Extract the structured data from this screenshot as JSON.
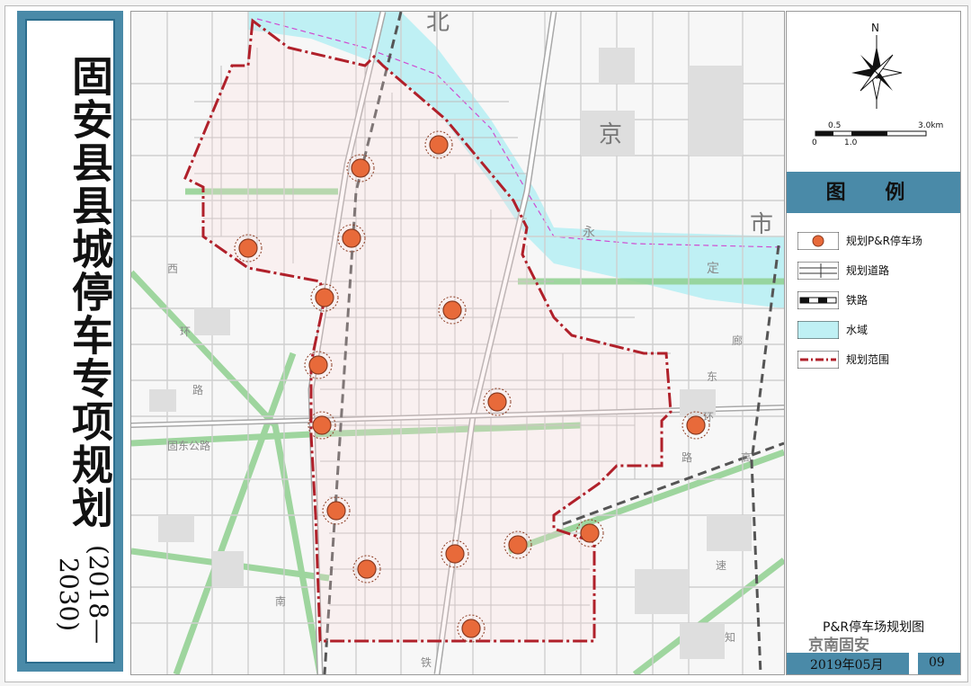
{
  "title": {
    "main": "固安县县城停车专项规划",
    "years": "(2018—2030)"
  },
  "map": {
    "place_labels": {
      "bei": "北",
      "jing": "京",
      "shi": "市",
      "yong": "永",
      "ding": "定",
      "xi": "西",
      "huan": "环",
      "lu": "路",
      "gudong_lu": "固东公路",
      "nan": "南",
      "tie": "铁",
      "langfang": "廊",
      "dong": "东",
      "huan2": "环",
      "lu2": "路",
      "zhi": "知",
      "gao": "高",
      "su": "速"
    },
    "colors": {
      "boundary": "#b0202a",
      "water": "#bff0f4",
      "road": "#c9c9c9",
      "green_road": "#8fd08f",
      "parking": "#e86a3a"
    },
    "parking_count": 17
  },
  "legend": {
    "compass_label": "N",
    "scale_labels": [
      "0",
      "0.5",
      "1.0",
      "3.0km"
    ],
    "title": "图 例",
    "items": [
      {
        "label": "规划P&R停车场",
        "icon": "parking-marker-icon"
      },
      {
        "label": "规划道路",
        "icon": "planned-road-icon"
      },
      {
        "label": "铁路",
        "icon": "railway-icon"
      },
      {
        "label": "水域",
        "icon": "water-icon"
      },
      {
        "label": "规划范围",
        "icon": "boundary-line-icon"
      }
    ],
    "map_name": "P&R停车场规划图",
    "date": "2019年05月",
    "sheet": "09",
    "watermark": "京南固安"
  }
}
